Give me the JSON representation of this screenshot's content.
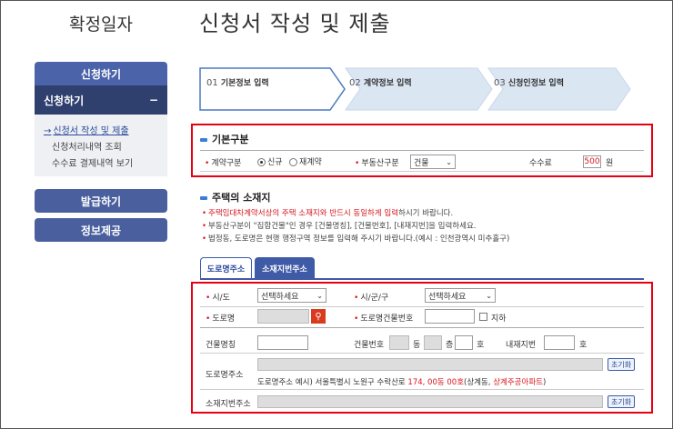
{
  "app_title": "확정일자",
  "page_title": "신청서 작성 및 제출",
  "sidebar": {
    "apply_header": "신청하기",
    "apply_open": "신청하기",
    "apply_toggle": "−",
    "sub_items": [
      "신청서 작성 및 제출",
      "신청처리내역 조회",
      "수수료 결제내역 보기"
    ],
    "sub_active_arrow": "→",
    "issue": "발급하기",
    "info": "정보제공"
  },
  "steps": [
    {
      "num": "01",
      "label": "기본정보 입력"
    },
    {
      "num": "02",
      "label": "계약정보 입력"
    },
    {
      "num": "03",
      "label": "신청인정보 입력"
    }
  ],
  "basic": {
    "title": "기본구분",
    "contract_type_label": "계약구분",
    "option_new": "신규",
    "option_renew": "재계약",
    "property_type_label": "부동산구분",
    "property_type_value": "건물",
    "fee_label": "수수료",
    "fee_value": "500",
    "fee_unit": "원"
  },
  "address": {
    "title": "주택의 소재지",
    "notes": [
      {
        "red": "주택임대차계약서상의 주택 소재지와 반드시 동일하게 입력",
        "rest": "하시기 바랍니다."
      },
      {
        "red": "",
        "rest": "부동산구분이 \"집합건물\"인 경우 [건물명칭], [건물번호], [내재지번]을 입력하세요."
      },
      {
        "red": "",
        "rest": "법정동, 도로명은 현행 행정구역 정보를 입력해 주시기 바랍니다.(예시 : 인천광역시 미추홀구)"
      }
    ],
    "tab_road": "도로명주소",
    "tab_lot": "소재지번주소",
    "sido_label": "시/도",
    "sido_placeholder": "선택하세요",
    "sigungu_label": "시/군/구",
    "sigungu_placeholder": "선택하세요",
    "road_label": "도로명",
    "building_no_label": "도로명건물번호",
    "basement_label": "지하",
    "building_name_label": "건물명칭",
    "building_number_label": "건물번호",
    "dong_unit": "동",
    "floor_unit": "층",
    "ho_unit": "호",
    "inner_lot_label": "내재지번",
    "inner_ho_unit": "호",
    "road_address_label": "도로명주소",
    "reset_label": "초기화",
    "example_prefix": "도로명주소 예시) 서울특별시 노원구 수락산로 ",
    "example_red1": "174, 00동 00호",
    "example_mid": "(상계동, ",
    "example_red2": "상계주공아파트",
    "example_end": ")",
    "lot_address_label": "소재지번주소",
    "reset_label2": "초기화"
  },
  "colors": {
    "accent": "#3f5aa6",
    "highlight_box": "#e60012",
    "required": "#d7161e"
  }
}
